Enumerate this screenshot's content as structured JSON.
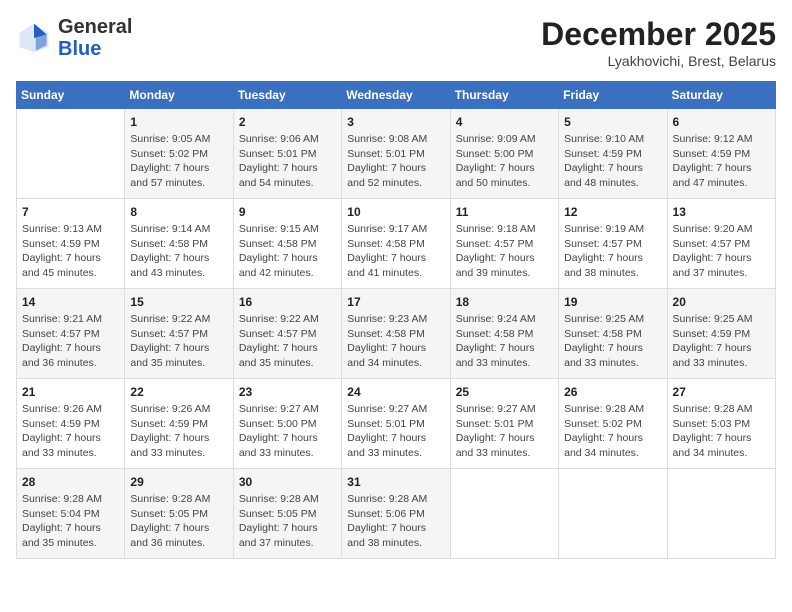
{
  "header": {
    "logo_general": "General",
    "logo_blue": "Blue",
    "month": "December 2025",
    "location": "Lyakhovichi, Brest, Belarus"
  },
  "weekdays": [
    "Sunday",
    "Monday",
    "Tuesday",
    "Wednesday",
    "Thursday",
    "Friday",
    "Saturday"
  ],
  "weeks": [
    [
      {
        "day": "",
        "info": ""
      },
      {
        "day": "1",
        "info": "Sunrise: 9:05 AM\nSunset: 5:02 PM\nDaylight: 7 hours\nand 57 minutes."
      },
      {
        "day": "2",
        "info": "Sunrise: 9:06 AM\nSunset: 5:01 PM\nDaylight: 7 hours\nand 54 minutes."
      },
      {
        "day": "3",
        "info": "Sunrise: 9:08 AM\nSunset: 5:01 PM\nDaylight: 7 hours\nand 52 minutes."
      },
      {
        "day": "4",
        "info": "Sunrise: 9:09 AM\nSunset: 5:00 PM\nDaylight: 7 hours\nand 50 minutes."
      },
      {
        "day": "5",
        "info": "Sunrise: 9:10 AM\nSunset: 4:59 PM\nDaylight: 7 hours\nand 48 minutes."
      },
      {
        "day": "6",
        "info": "Sunrise: 9:12 AM\nSunset: 4:59 PM\nDaylight: 7 hours\nand 47 minutes."
      }
    ],
    [
      {
        "day": "7",
        "info": "Sunrise: 9:13 AM\nSunset: 4:59 PM\nDaylight: 7 hours\nand 45 minutes."
      },
      {
        "day": "8",
        "info": "Sunrise: 9:14 AM\nSunset: 4:58 PM\nDaylight: 7 hours\nand 43 minutes."
      },
      {
        "day": "9",
        "info": "Sunrise: 9:15 AM\nSunset: 4:58 PM\nDaylight: 7 hours\nand 42 minutes."
      },
      {
        "day": "10",
        "info": "Sunrise: 9:17 AM\nSunset: 4:58 PM\nDaylight: 7 hours\nand 41 minutes."
      },
      {
        "day": "11",
        "info": "Sunrise: 9:18 AM\nSunset: 4:57 PM\nDaylight: 7 hours\nand 39 minutes."
      },
      {
        "day": "12",
        "info": "Sunrise: 9:19 AM\nSunset: 4:57 PM\nDaylight: 7 hours\nand 38 minutes."
      },
      {
        "day": "13",
        "info": "Sunrise: 9:20 AM\nSunset: 4:57 PM\nDaylight: 7 hours\nand 37 minutes."
      }
    ],
    [
      {
        "day": "14",
        "info": "Sunrise: 9:21 AM\nSunset: 4:57 PM\nDaylight: 7 hours\nand 36 minutes."
      },
      {
        "day": "15",
        "info": "Sunrise: 9:22 AM\nSunset: 4:57 PM\nDaylight: 7 hours\nand 35 minutes."
      },
      {
        "day": "16",
        "info": "Sunrise: 9:22 AM\nSunset: 4:57 PM\nDaylight: 7 hours\nand 35 minutes."
      },
      {
        "day": "17",
        "info": "Sunrise: 9:23 AM\nSunset: 4:58 PM\nDaylight: 7 hours\nand 34 minutes."
      },
      {
        "day": "18",
        "info": "Sunrise: 9:24 AM\nSunset: 4:58 PM\nDaylight: 7 hours\nand 33 minutes."
      },
      {
        "day": "19",
        "info": "Sunrise: 9:25 AM\nSunset: 4:58 PM\nDaylight: 7 hours\nand 33 minutes."
      },
      {
        "day": "20",
        "info": "Sunrise: 9:25 AM\nSunset: 4:59 PM\nDaylight: 7 hours\nand 33 minutes."
      }
    ],
    [
      {
        "day": "21",
        "info": "Sunrise: 9:26 AM\nSunset: 4:59 PM\nDaylight: 7 hours\nand 33 minutes."
      },
      {
        "day": "22",
        "info": "Sunrise: 9:26 AM\nSunset: 4:59 PM\nDaylight: 7 hours\nand 33 minutes."
      },
      {
        "day": "23",
        "info": "Sunrise: 9:27 AM\nSunset: 5:00 PM\nDaylight: 7 hours\nand 33 minutes."
      },
      {
        "day": "24",
        "info": "Sunrise: 9:27 AM\nSunset: 5:01 PM\nDaylight: 7 hours\nand 33 minutes."
      },
      {
        "day": "25",
        "info": "Sunrise: 9:27 AM\nSunset: 5:01 PM\nDaylight: 7 hours\nand 33 minutes."
      },
      {
        "day": "26",
        "info": "Sunrise: 9:28 AM\nSunset: 5:02 PM\nDaylight: 7 hours\nand 34 minutes."
      },
      {
        "day": "27",
        "info": "Sunrise: 9:28 AM\nSunset: 5:03 PM\nDaylight: 7 hours\nand 34 minutes."
      }
    ],
    [
      {
        "day": "28",
        "info": "Sunrise: 9:28 AM\nSunset: 5:04 PM\nDaylight: 7 hours\nand 35 minutes."
      },
      {
        "day": "29",
        "info": "Sunrise: 9:28 AM\nSunset: 5:05 PM\nDaylight: 7 hours\nand 36 minutes."
      },
      {
        "day": "30",
        "info": "Sunrise: 9:28 AM\nSunset: 5:05 PM\nDaylight: 7 hours\nand 37 minutes."
      },
      {
        "day": "31",
        "info": "Sunrise: 9:28 AM\nSunset: 5:06 PM\nDaylight: 7 hours\nand 38 minutes."
      },
      {
        "day": "",
        "info": ""
      },
      {
        "day": "",
        "info": ""
      },
      {
        "day": "",
        "info": ""
      }
    ]
  ]
}
